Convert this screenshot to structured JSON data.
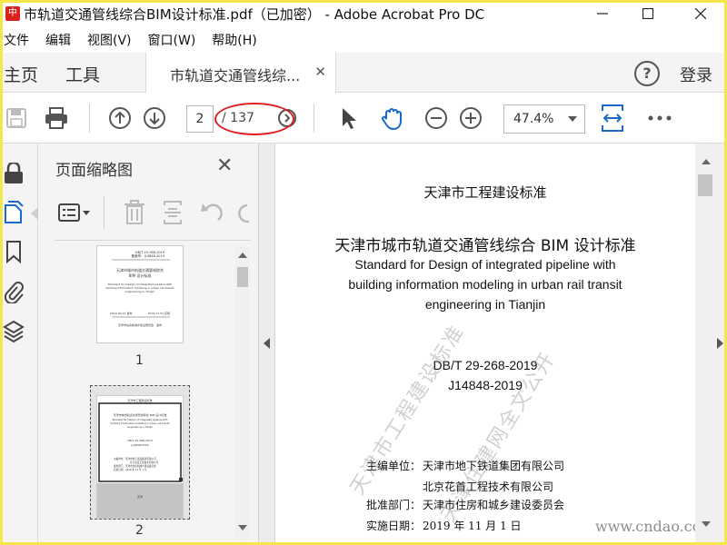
{
  "window": {
    "title": "市轨道交通管线综合BIM设计标准.pdf（已加密） - Adobe Acrobat Pro DC",
    "app_icon_label": "中",
    "minimize_icon": "minimize-icon",
    "maximize_icon": "maximize-icon",
    "close_icon": "close-icon"
  },
  "menu": {
    "items": [
      "文件",
      "编辑",
      "视图(V)",
      "窗口(W)",
      "帮助(H)"
    ]
  },
  "tabs": {
    "home": "主页",
    "tools": "工具",
    "document": "市轨道交通管线综...",
    "help": "?",
    "login": "登录"
  },
  "toolbar": {
    "page_current": "2",
    "page_total": "/ 137",
    "zoom": "47.4%",
    "annotation_color": "#e02020"
  },
  "thumbnails_panel": {
    "title": "页面缩略图",
    "pages": [
      {
        "number": "1",
        "lines": [
          "DB/T 29-268-2019",
          "备案号：J14848-2019",
          "天津市城市轨道交通管线综合",
          "BIM 设计标准",
          "Standard for Design of integrated pipeline with",
          "building information modeling in urban rail transit",
          "engineering in Tianjin",
          "2019-09-12 发布",
          "2019-11-01 实施",
          "天津市住房和城乡建设委员会　发布"
        ]
      },
      {
        "number": "2",
        "lines": [
          "天津市工程建设标准",
          "天津市城市轨道交通管线综合 BIM 设计标准",
          "Standard for Design of integrated pipeline with",
          "building information modeling in urban rail transit",
          "engineering in Tianjin",
          "DB/T 29-268-2019",
          "J14848-2019",
          "主编单位：天津市地下铁道集团有限公司",
          "北京花首工程技术有限公司",
          "批准部门：天津市住房和城乡建设委员会",
          "实施日期：2019 年 11 月 1 日",
          "天津"
        ]
      }
    ]
  },
  "document": {
    "header": "天津市工程建设标准",
    "title_cn": "天津市城市轨道交通管线综合 BIM 设计标准",
    "title_en": [
      "Standard for Design of integrated pipeline with",
      "building information modeling in urban rail transit",
      "engineering in Tianjin"
    ],
    "standard_no": "DB/T 29-268-2019",
    "record_no": "J14848-2019",
    "editor_label": "主编单位：",
    "editor_1": "天津市地下铁道集团有限公司",
    "editor_2": "北京花首工程技术有限公司",
    "approver_label": "批准部门：",
    "approver": "天津市住房和城乡建设委员会",
    "date_label": "实施日期：",
    "date": "2019 年 11 月 1 日",
    "watermark_1": "天津市工程建设标准",
    "watermark_2": "天津住建网全文公开",
    "site_mark": "www.cndao.com"
  }
}
